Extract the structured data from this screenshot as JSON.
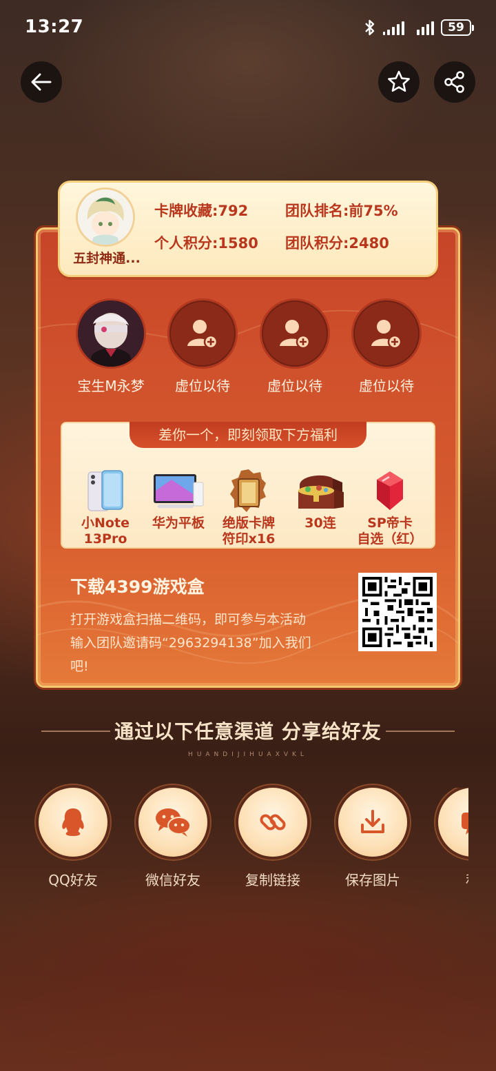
{
  "status_bar": {
    "time": "13:27",
    "battery": "59"
  },
  "nav": {
    "back_icon": "arrow-left-icon",
    "favorite_icon": "star-icon",
    "share_icon": "share-icon"
  },
  "profile": {
    "username": "五封神通...",
    "card_collection": "卡牌收藏:792",
    "team_rank": "团队排名:前75%",
    "personal_points": "个人积分:1580",
    "team_points": "团队积分:2480"
  },
  "team": {
    "members": [
      {
        "name": "宝生M永梦",
        "filled": true
      },
      {
        "name": "虚位以待",
        "filled": false
      },
      {
        "name": "虚位以待",
        "filled": false
      },
      {
        "name": "虚位以待",
        "filled": false
      }
    ]
  },
  "rewards": {
    "banner": "差你一个，即刻领取下方福利",
    "items": [
      {
        "line1": "小Note",
        "line2": "13Pro"
      },
      {
        "line1": "华为平板",
        "line2": ""
      },
      {
        "line1": "绝版卡牌",
        "line2": "符印x16"
      },
      {
        "line1": "30连",
        "line2": ""
      },
      {
        "line1": "SP帝卡",
        "line2": "自选（红）"
      }
    ]
  },
  "download": {
    "title": "下载4399游戏盒",
    "line1": "打开游戏盒扫描二维码，即可参与本活动",
    "line2": "输入团队邀请码“2963294138”加入我们",
    "line3": "吧!"
  },
  "share": {
    "title": "通过以下任意渠道 分享给好友",
    "subtitle": "HUANDIJIHUAXVKL",
    "channels": [
      {
        "label": "QQ好友",
        "icon": "qq-icon"
      },
      {
        "label": "微信好友",
        "icon": "wechat-icon"
      },
      {
        "label": "复制链接",
        "icon": "link-icon"
      },
      {
        "label": "保存图片",
        "icon": "download-icon"
      },
      {
        "label": "私",
        "icon": "message-icon"
      }
    ]
  },
  "colors": {
    "accent": "#c64428",
    "gold": "#f1c76f",
    "cream": "#fff6dc"
  }
}
